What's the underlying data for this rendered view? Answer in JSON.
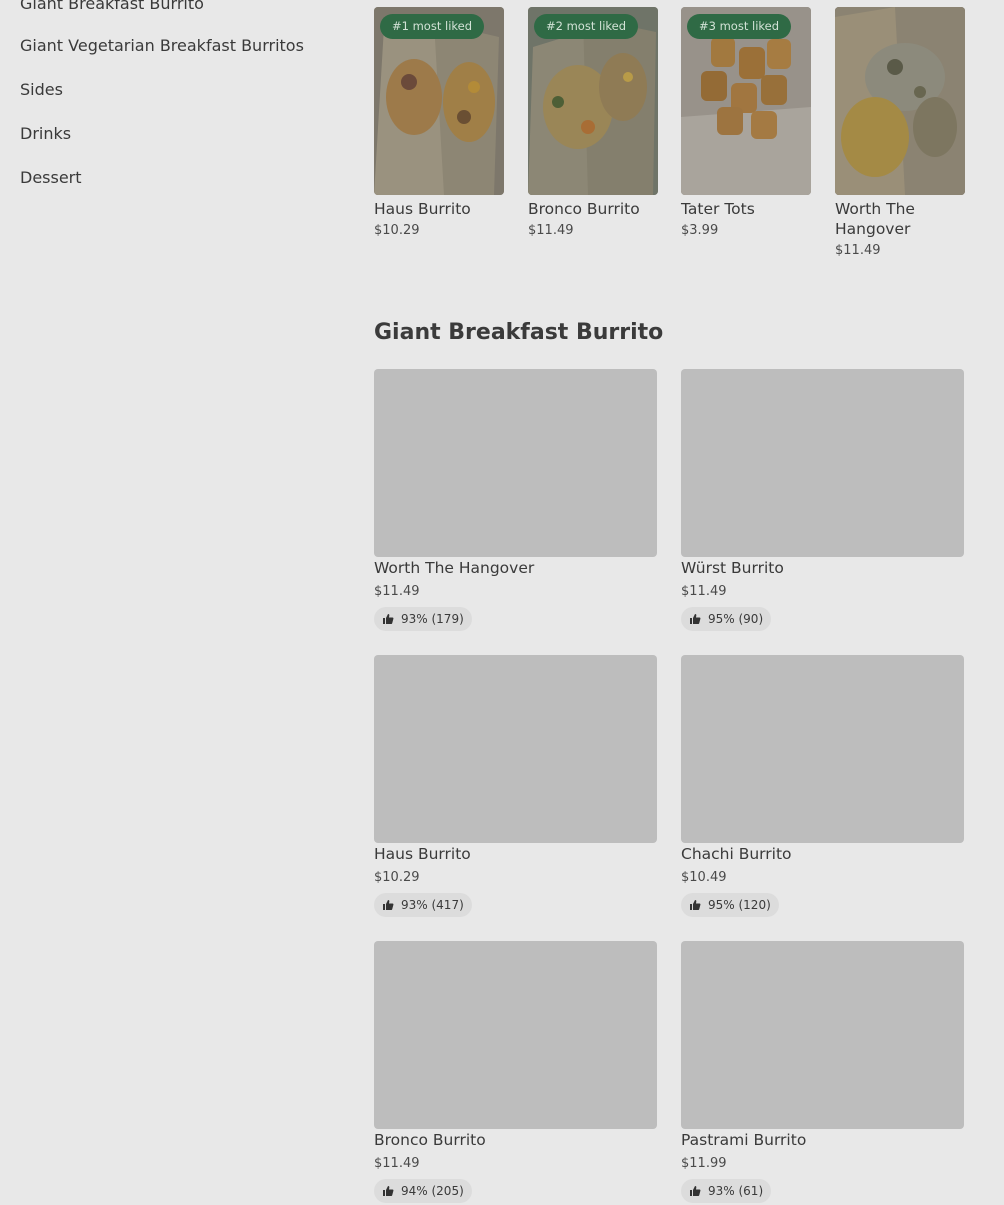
{
  "sidebar": {
    "categories": [
      "Giant Breakfast Burrito",
      "Giant Vegetarian Breakfast Burritos",
      "Sides",
      "Drinks",
      "Dessert"
    ]
  },
  "popular": {
    "items": [
      {
        "name": "Haus Burrito",
        "price": "$10.29",
        "badge": "#1 most liked"
      },
      {
        "name": "Bronco Burrito",
        "price": "$11.49",
        "badge": "#2 most liked"
      },
      {
        "name": "Tater Tots",
        "price": "$3.99",
        "badge": "#3 most liked"
      },
      {
        "name": "Worth The Hangover",
        "price": "$11.49",
        "badge": ""
      }
    ]
  },
  "section": {
    "title": "Giant Breakfast Burrito",
    "items": [
      {
        "name": "Worth The Hangover",
        "price": "$11.49",
        "rating": "93% (179)"
      },
      {
        "name": "Würst Burrito",
        "price": "$11.49",
        "rating": "95% (90)"
      },
      {
        "name": "Haus Burrito",
        "price": "$10.29",
        "rating": "93% (417)"
      },
      {
        "name": "Chachi Burrito",
        "price": "$10.49",
        "rating": "95% (120)"
      },
      {
        "name": "Bronco Burrito",
        "price": "$11.49",
        "rating": "94% (205)"
      },
      {
        "name": "Pastrami Burrito",
        "price": "$11.99",
        "rating": "93% (61)"
      }
    ]
  },
  "icons": {
    "rating": "thumbs-up-icon"
  },
  "colors": {
    "badge_bg": "#2f6a45",
    "placeholder_bg": "#bdbdbd",
    "page_bg": "#e8e8e8"
  }
}
